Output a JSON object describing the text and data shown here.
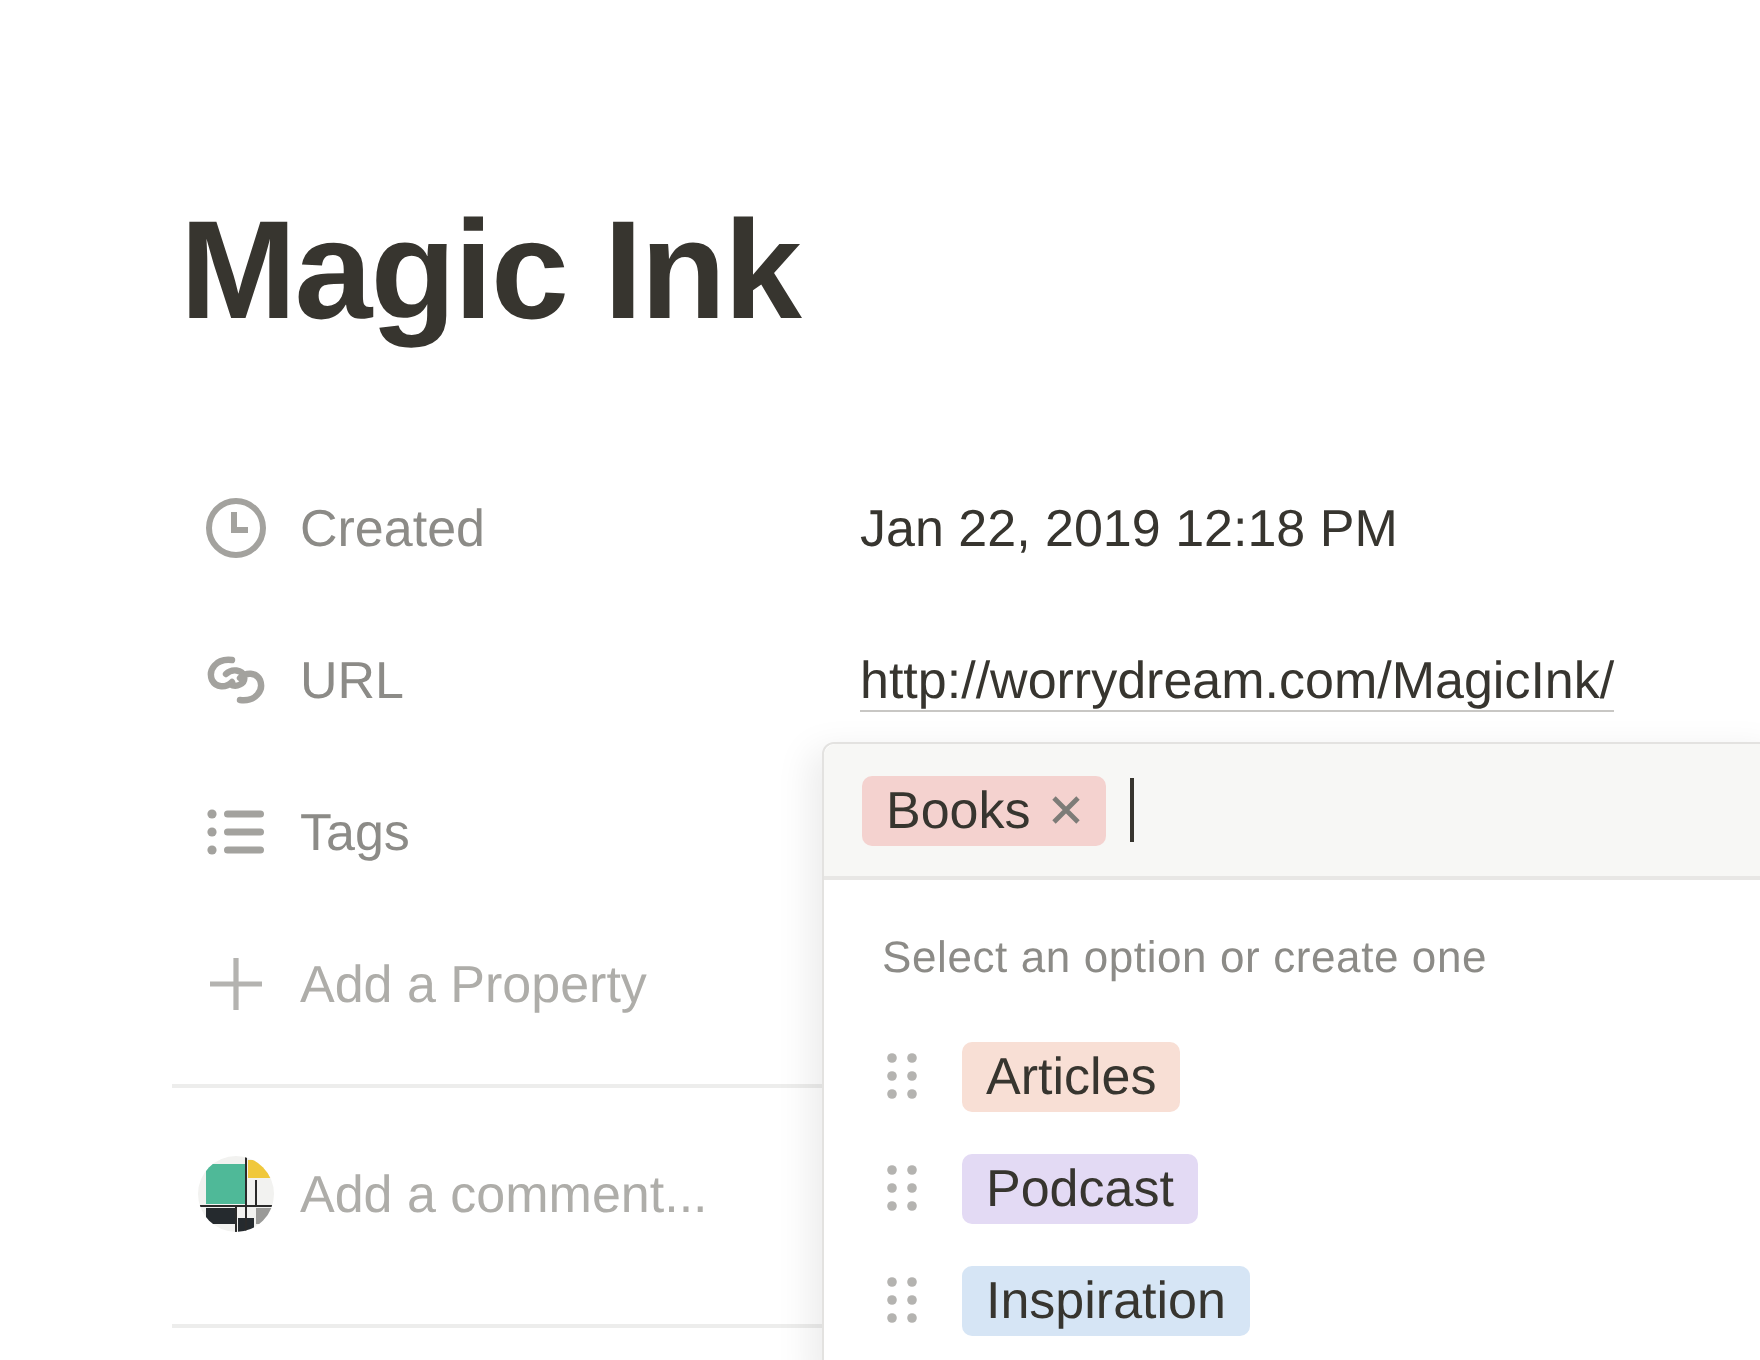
{
  "page": {
    "title": "Magic Ink"
  },
  "properties": [
    {
      "kind": "created",
      "label": "Created",
      "value": "Jan 22, 2019 12:18 PM"
    },
    {
      "kind": "url",
      "label": "URL",
      "value": "http://worrydream.com/MagicInk/"
    },
    {
      "kind": "tags",
      "label": "Tags"
    }
  ],
  "add_property": {
    "label": "Add a Property"
  },
  "comment": {
    "placeholder": "Add a comment..."
  },
  "tag_menu": {
    "selected_tags": [
      {
        "label": "Books",
        "color": "#f4d2cf"
      }
    ],
    "hint": "Select an option or create one",
    "options": [
      {
        "label": "Articles",
        "color": "#f8dfd5"
      },
      {
        "label": "Podcast",
        "color": "#e3daf4"
      },
      {
        "label": "Inspiration",
        "color": "#d6e5f5"
      }
    ]
  }
}
